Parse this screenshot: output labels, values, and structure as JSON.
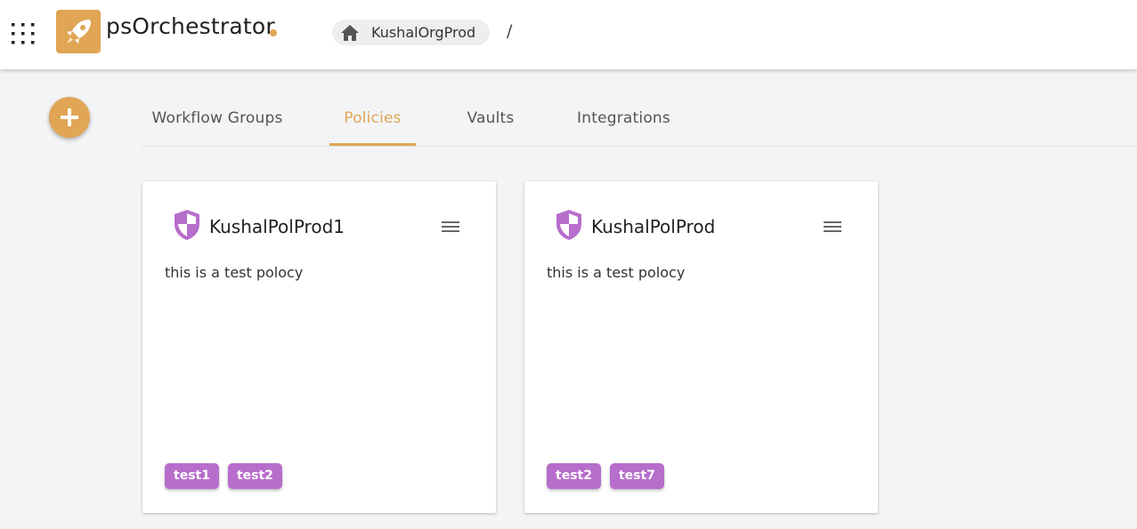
{
  "colors": {
    "accent": "#e0a555",
    "purple": "#b76dcc",
    "text": "#222222"
  },
  "header": {
    "brand": "psOrchestrator",
    "breadcrumb": {
      "org": "KushalOrgProd",
      "separator": "/"
    }
  },
  "tabs": [
    {
      "label": "Workflow Groups",
      "active": false
    },
    {
      "label": "Policies",
      "active": true
    },
    {
      "label": "Vaults",
      "active": false
    },
    {
      "label": "Integrations",
      "active": false
    }
  ],
  "cards": [
    {
      "title": "KushalPolProd1",
      "description": "this is a test polocy",
      "tags": [
        "test1",
        "test2"
      ]
    },
    {
      "title": "KushalPolProd",
      "description": "this is a test polocy",
      "tags": [
        "test2",
        "test7"
      ]
    }
  ],
  "icons": {
    "apps": "apps-grid-icon",
    "logo": "rocket-icon",
    "home": "home-icon",
    "add": "plus-icon",
    "policy": "shield-icon",
    "menu": "hamburger-menu-icon"
  }
}
